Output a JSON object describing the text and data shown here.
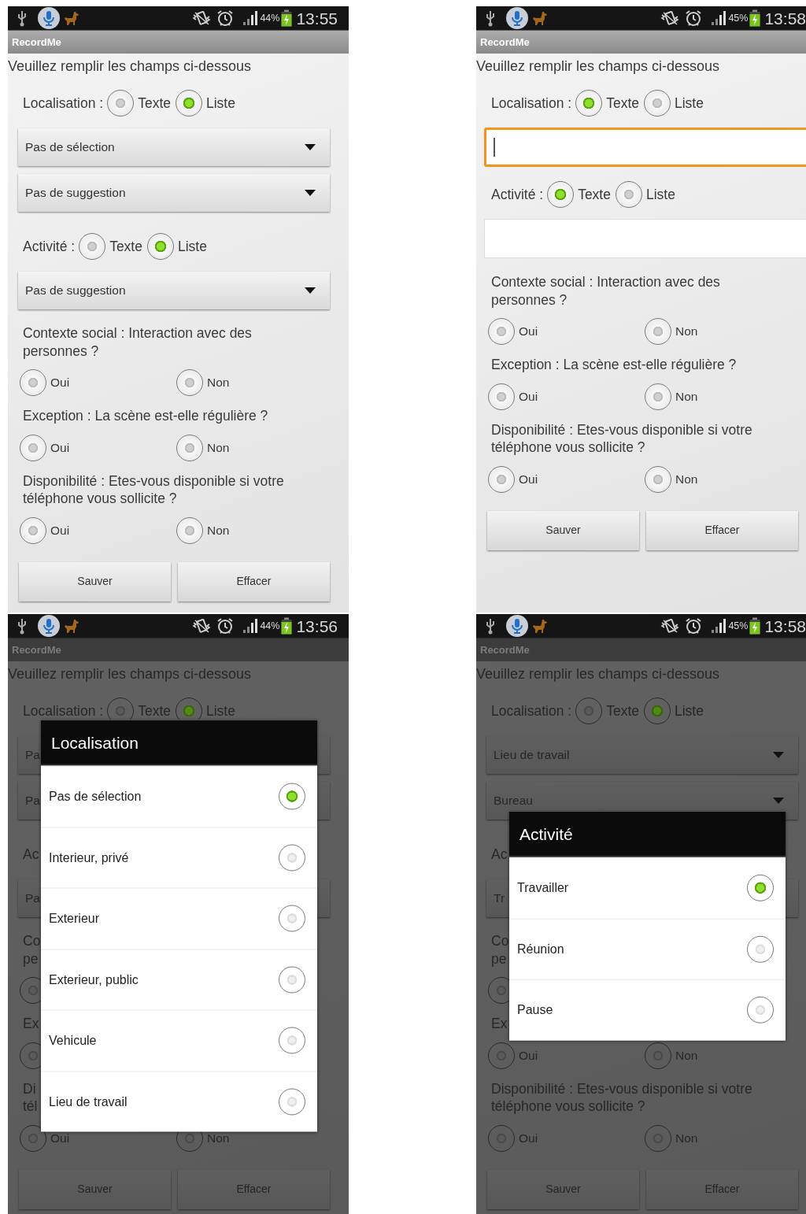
{
  "screens": [
    {
      "status": {
        "battery": "44%",
        "time": "13:55"
      },
      "app_title": "RecordMe",
      "dimmed": false,
      "intro": "Veuillez remplir les champs ci-dessous",
      "rows": [
        {
          "kind": "choice",
          "label": "Localisation :",
          "options": [
            {
              "label": "Texte",
              "selected": false
            },
            {
              "label": "Liste",
              "selected": true
            }
          ]
        },
        {
          "kind": "spinner",
          "value": "Pas de sélection"
        },
        {
          "kind": "spinner",
          "value": "Pas de suggestion"
        },
        {
          "kind": "choice",
          "label": "Activité :",
          "options": [
            {
              "label": "Texte",
              "selected": false
            },
            {
              "label": "Liste",
              "selected": true
            }
          ]
        },
        {
          "kind": "spinner",
          "value": "Pas de suggestion"
        },
        {
          "kind": "question",
          "text": "Contexte social : Interaction avec des personnes ?"
        },
        {
          "kind": "answers",
          "options": [
            {
              "label": "Oui",
              "selected": false
            },
            {
              "label": "Non",
              "selected": false
            }
          ]
        },
        {
          "kind": "question",
          "text": "Exception : La scène est-elle régulière ?"
        },
        {
          "kind": "answers",
          "options": [
            {
              "label": "Oui",
              "selected": false
            },
            {
              "label": "Non",
              "selected": false
            }
          ]
        },
        {
          "kind": "question",
          "text": "Disponibilité : Etes-vous disponible si votre téléphone vous sollicite ?"
        },
        {
          "kind": "answers",
          "options": [
            {
              "label": "Oui",
              "selected": false
            },
            {
              "label": "Non",
              "selected": false
            }
          ]
        },
        {
          "kind": "buttons",
          "buttons": [
            "Sauver",
            "Effacer"
          ]
        }
      ]
    },
    {
      "status": {
        "battery": "45%",
        "time": "13:58"
      },
      "app_title": "RecordMe",
      "dimmed": false,
      "intro": "Veuillez remplir les champs ci-dessous",
      "rows": [
        {
          "kind": "choice",
          "label": "Localisation :",
          "options": [
            {
              "label": "Texte",
              "selected": true
            },
            {
              "label": "Liste",
              "selected": false
            }
          ]
        },
        {
          "kind": "input",
          "focused": true
        },
        {
          "kind": "choice",
          "label": "Activité :",
          "options": [
            {
              "label": "Texte",
              "selected": true
            },
            {
              "label": "Liste",
              "selected": false
            }
          ]
        },
        {
          "kind": "input",
          "focused": false
        },
        {
          "kind": "question",
          "text": "Contexte social : Interaction avec des personnes ?"
        },
        {
          "kind": "answers",
          "options": [
            {
              "label": "Oui",
              "selected": false
            },
            {
              "label": "Non",
              "selected": false
            }
          ]
        },
        {
          "kind": "question",
          "text": "Exception : La scène est-elle régulière ?"
        },
        {
          "kind": "answers",
          "options": [
            {
              "label": "Oui",
              "selected": false
            },
            {
              "label": "Non",
              "selected": false
            }
          ]
        },
        {
          "kind": "question",
          "text": "Disponibilité : Etes-vous disponible si votre téléphone vous sollicite ?"
        },
        {
          "kind": "answers",
          "options": [
            {
              "label": "Oui",
              "selected": false
            },
            {
              "label": "Non",
              "selected": false
            }
          ]
        },
        {
          "kind": "buttons",
          "buttons": [
            "Sauver",
            "Effacer"
          ]
        }
      ]
    },
    {
      "status": {
        "battery": "44%",
        "time": "13:56"
      },
      "app_title": "RecordMe",
      "dimmed": true,
      "intro": "Veuillez remplir les champs ci-dessous",
      "rows": [
        {
          "kind": "choice",
          "label": "Localisation :",
          "options": [
            {
              "label": "Texte",
              "selected": false
            },
            {
              "label": "Liste",
              "selected": true
            }
          ]
        },
        {
          "kind": "spinner_part",
          "value": "Pa"
        },
        {
          "kind": "spinner_part",
          "value": "Pa"
        },
        {
          "kind": "choice_part",
          "label": "Ac"
        },
        {
          "kind": "spinner_part",
          "value": "Pa"
        },
        {
          "kind": "question_part",
          "lines": [
            "Co",
            "pe"
          ]
        },
        {
          "kind": "answers",
          "options": [
            {
              "selected": false
            }
          ]
        },
        {
          "kind": "question_part",
          "lines": [
            "Ex"
          ]
        },
        {
          "kind": "answers",
          "options": [
            {
              "selected": false
            }
          ]
        },
        {
          "kind": "question_part",
          "lines": [
            "Di",
            "tél"
          ]
        },
        {
          "kind": "answers",
          "options": [
            {
              "label": "Oui",
              "selected": false
            },
            {
              "label": "Non",
              "selected": false
            }
          ]
        },
        {
          "kind": "buttons",
          "buttons": [
            "Sauver",
            "Effacer"
          ]
        }
      ],
      "dialog": {
        "title": "Localisation",
        "options": [
          {
            "label": "Pas de sélection",
            "selected": true
          },
          {
            "label": "Interieur, privé",
            "selected": false
          },
          {
            "label": "Exterieur",
            "selected": false
          },
          {
            "label": "Exterieur, public",
            "selected": false
          },
          {
            "label": "Vehicule",
            "selected": false
          },
          {
            "label": "Lieu de travail",
            "selected": false
          }
        ]
      }
    },
    {
      "status": {
        "battery": "45%",
        "time": "13:58"
      },
      "app_title": "RecordMe",
      "dimmed": true,
      "intro": "Veuillez remplir les champs ci-dessous",
      "rows": [
        {
          "kind": "choice",
          "label": "Localisation :",
          "options": [
            {
              "label": "Texte",
              "selected": false
            },
            {
              "label": "Liste",
              "selected": true
            }
          ]
        },
        {
          "kind": "spinner",
          "value": "Lieu de travail"
        },
        {
          "kind": "spinner",
          "value": "Bureau"
        },
        {
          "kind": "choice_part",
          "label": "Ac"
        },
        {
          "kind": "spinner_part",
          "value": "Tr"
        },
        {
          "kind": "question_part",
          "lines": [
            "Co",
            "pe"
          ]
        },
        {
          "kind": "answers",
          "options": [
            {
              "selected": false
            }
          ]
        },
        {
          "kind": "question_part",
          "lines": [
            "Ex"
          ]
        },
        {
          "kind": "answers",
          "options": [
            {
              "label": "Oui",
              "selected": false
            },
            {
              "label": "Non",
              "selected": false
            }
          ]
        },
        {
          "kind": "question",
          "text": "Disponibilité : Etes-vous disponible si votre téléphone vous sollicite ?"
        },
        {
          "kind": "answers",
          "options": [
            {
              "label": "Oui",
              "selected": false
            },
            {
              "label": "Non",
              "selected": false
            }
          ]
        },
        {
          "kind": "buttons",
          "buttons": [
            "Sauver",
            "Effacer"
          ]
        }
      ],
      "dialog": {
        "title": "Activité",
        "options": [
          {
            "label": "Travailler",
            "selected": true
          },
          {
            "label": "Réunion",
            "selected": false
          },
          {
            "label": "Pause",
            "selected": false
          }
        ]
      }
    }
  ]
}
